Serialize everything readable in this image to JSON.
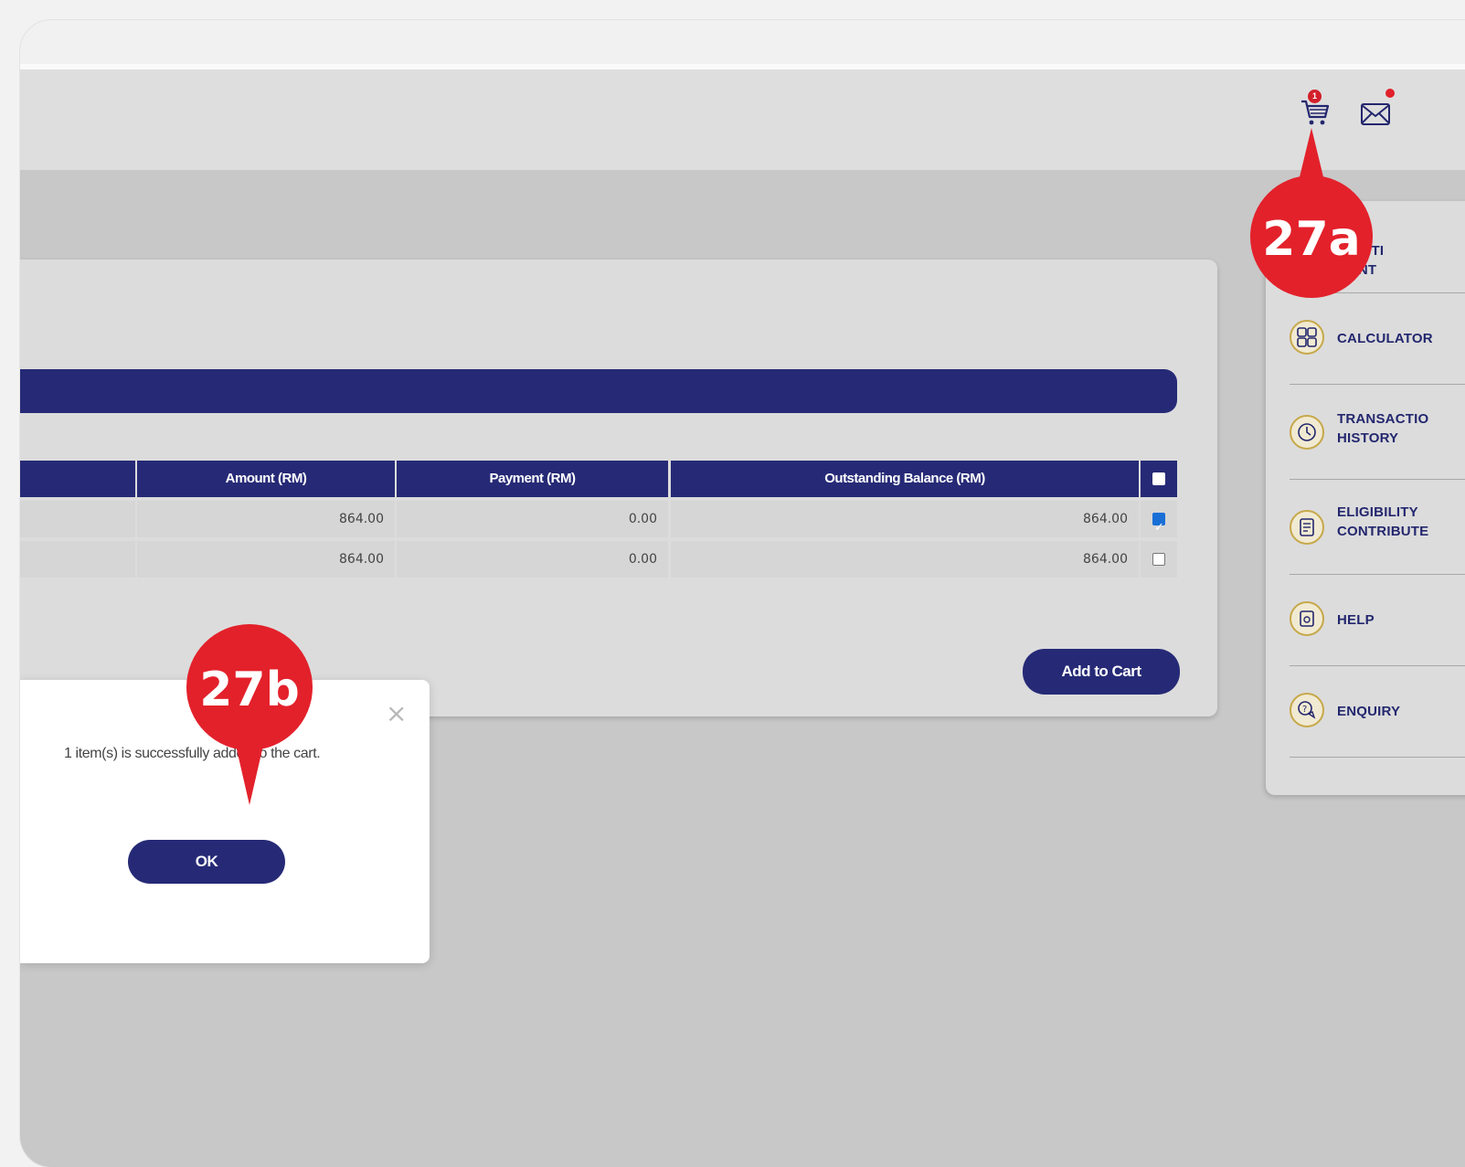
{
  "header": {
    "cart_badge": "1"
  },
  "table": {
    "columns": [
      "Amount (RM)",
      "Payment (RM)",
      "Outstanding Balance (RM)"
    ],
    "rows": [
      {
        "amount": "864.00",
        "payment": "0.00",
        "outstanding": "864.00",
        "checked": true
      },
      {
        "amount": "864.00",
        "payment": "0.00",
        "outstanding": "864.00",
        "checked": false
      }
    ],
    "add_to_cart": "Add to Cart"
  },
  "sidebar": {
    "items": [
      {
        "label": "RIBUTI\nMENT",
        "icon": "contribution-icon"
      },
      {
        "label": "CALCULATOR",
        "icon": "calculator-icon"
      },
      {
        "label": "TRANSACTIO\nHISTORY",
        "icon": "clock-icon"
      },
      {
        "label": "ELIGIBILITY\nCONTRIBUTE",
        "icon": "document-icon"
      },
      {
        "label": "HELP",
        "icon": "help-icon"
      },
      {
        "label": "ENQUIRY",
        "icon": "enquiry-icon"
      }
    ]
  },
  "dialog": {
    "message": "1 item(s) is successfully added to the cart.",
    "ok_label": "OK",
    "close_symbol": "×"
  },
  "annotations": {
    "pin_a": "27a",
    "pin_b": "27b",
    "pin_color": "#e3212b"
  },
  "colors": {
    "primary": "#262a76",
    "accent_gold": "#c6a84a"
  }
}
